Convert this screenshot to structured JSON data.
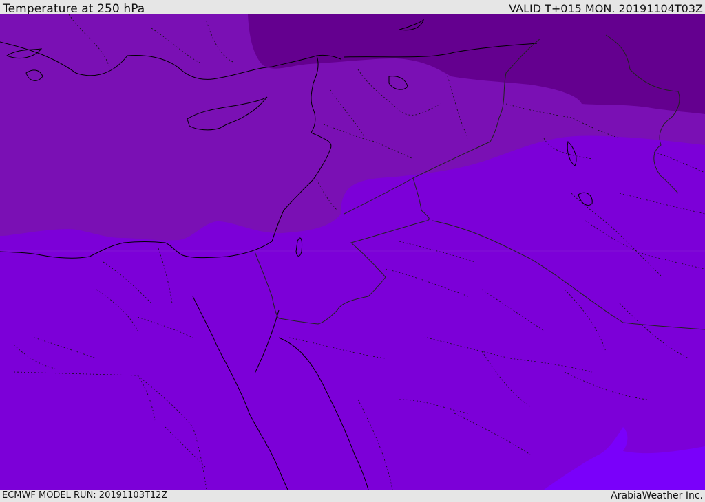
{
  "header": {
    "title": "Temperature at 250 hPa",
    "valid_time": "VALID T+015 MON. 20191104T03Z"
  },
  "footer": {
    "model_run": "ECMWF MODEL RUN: 20191103T12Z",
    "credit": "ArabiaWeather Inc."
  },
  "map": {
    "colors": {
      "band_coldest": "#64008f",
      "band_cold": "#7a10b4",
      "band_mid": "#7c00d8",
      "band_warm": "#7a00fa",
      "coastline": "#000000",
      "border": "#222222"
    }
  }
}
